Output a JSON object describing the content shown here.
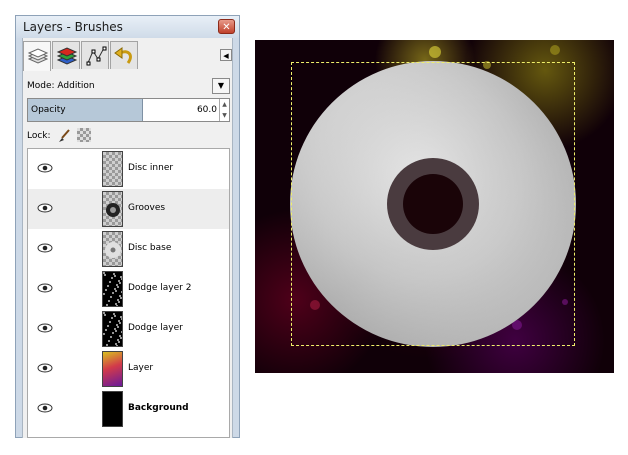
{
  "window": {
    "title": "Layers - Brushes",
    "close_glyph": "✕"
  },
  "tabs": [
    {
      "name": "layers-tab",
      "icon": "layers-icon",
      "active": true
    },
    {
      "name": "channels-tab",
      "icon": "channels-icon",
      "active": false
    },
    {
      "name": "paths-tab",
      "icon": "paths-icon",
      "active": false
    },
    {
      "name": "undo-tab",
      "icon": "undo-icon",
      "active": false
    }
  ],
  "mode": {
    "label": "Mode: Addition",
    "dropdown_glyph": "▼"
  },
  "opacity": {
    "label": "Opacity",
    "value": "60.0",
    "fraction": 0.6
  },
  "lock": {
    "label": "Lock:"
  },
  "layers": [
    {
      "name": "Disc inner",
      "selected": false,
      "bold": false,
      "thumb": "checker-ring"
    },
    {
      "name": "Grooves",
      "selected": true,
      "bold": false,
      "thumb": "checker-grooves"
    },
    {
      "name": "Disc base",
      "selected": false,
      "bold": false,
      "thumb": "checker-disc"
    },
    {
      "name": "Dodge layer 2",
      "selected": false,
      "bold": false,
      "thumb": "dots"
    },
    {
      "name": "Dodge layer",
      "selected": false,
      "bold": false,
      "thumb": "dots"
    },
    {
      "name": "Layer",
      "selected": false,
      "bold": false,
      "thumb": "color"
    },
    {
      "name": "Background",
      "selected": false,
      "bold": true,
      "thumb": "black"
    }
  ],
  "colors": {
    "panel_bg": "#cdd9e7",
    "selection": "#f0f06a",
    "canvas_bg": "#100008"
  }
}
